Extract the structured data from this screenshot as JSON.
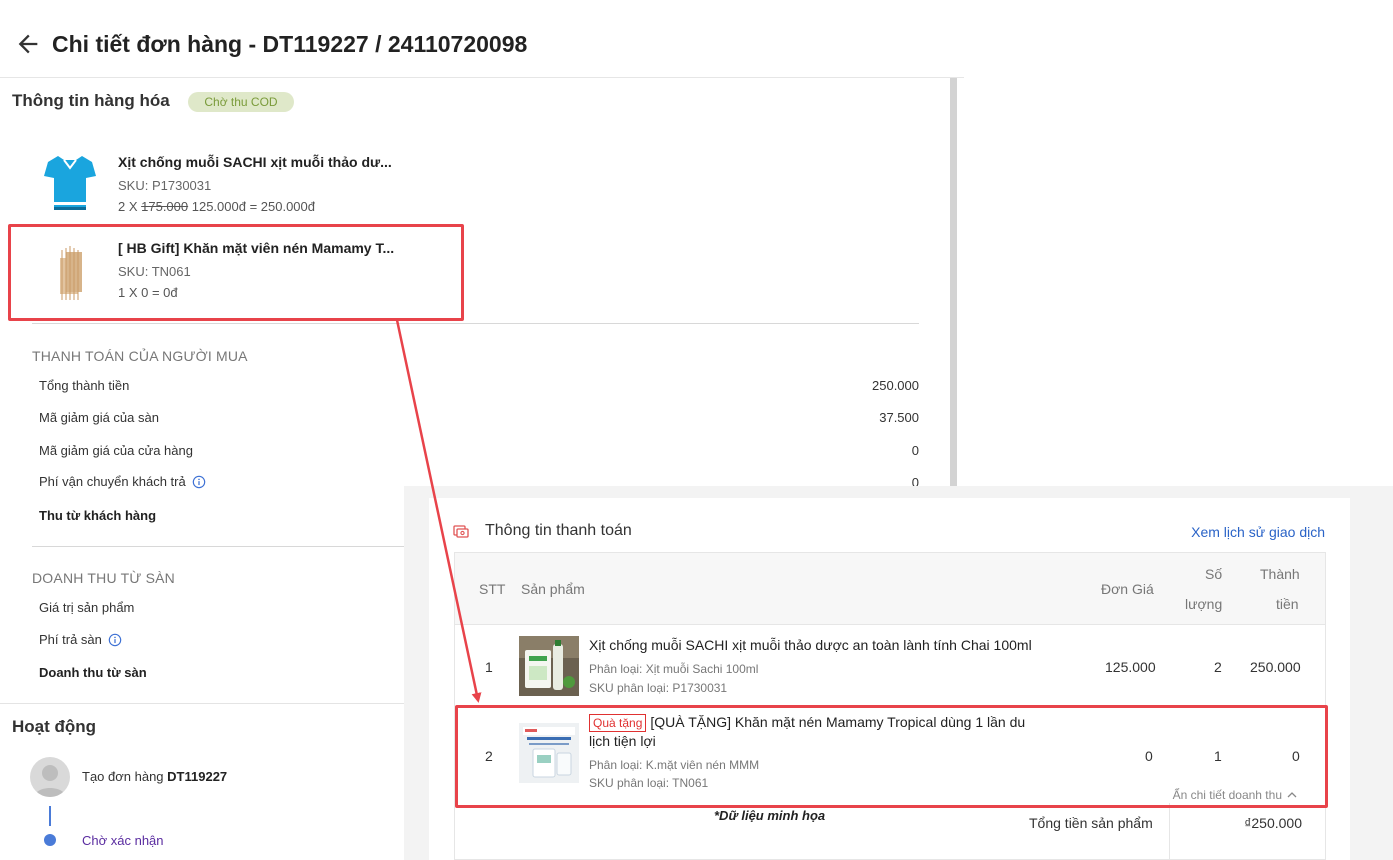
{
  "order": {
    "title": "Chi tiết đơn hàng - DT119227 / 24110720098"
  },
  "goods": {
    "heading": "Thông tin hàng hóa",
    "status_badge": "Chờ thu COD",
    "items": [
      {
        "name": "Xịt chống muỗi SACHI xịt muỗi thảo dư...",
        "sku": "SKU: P1730031",
        "qty_prefix": "2 X ",
        "old_price": "175.000",
        "price_suffix": " 125.000đ = 250.000đ",
        "icon": "tshirt-icon"
      },
      {
        "name": "[ HB Gift] Khăn mặt viên nén Mamamy T...",
        "sku": "SKU: TN061",
        "price_line": "1 X 0 = 0đ",
        "icon": "towel-icon"
      }
    ]
  },
  "buyer_payment": {
    "title": "THANH TOÁN CỦA NGƯỜI MUA",
    "rows": [
      {
        "label": "Tổng thành tiền",
        "value": "250.000"
      },
      {
        "label": "Mã giảm giá của sàn",
        "value": "37.500"
      },
      {
        "label": "Mã giảm giá của cửa hàng",
        "value": "0"
      },
      {
        "label": "Phí vận chuyển khách trả",
        "value": "0"
      },
      {
        "label": "Thu từ khách hàng",
        "value": ""
      }
    ]
  },
  "platform_revenue": {
    "title": "DOANH THU TỪ SÀN",
    "rows": [
      {
        "label": "Giá trị sản phẩm"
      },
      {
        "label": "Phí trả sàn"
      },
      {
        "label": "Doanh thu từ sàn"
      }
    ]
  },
  "activity": {
    "title": "Hoạt động",
    "created_prefix": "Tạo đơn hàng ",
    "created_order": "DT119227",
    "status": "Chờ xác nhận"
  },
  "payment_info": {
    "title": "Thông tin thanh toán",
    "history_link": "Xem lịch sử giao dịch",
    "columns": {
      "stt": "STT",
      "product": "Sản phẩm",
      "unit_price": "Đơn Giá",
      "qty_line1": "Số",
      "qty_line2": "lượng",
      "total_line1": "Thành",
      "total_line2": "tiền"
    },
    "rows": [
      {
        "stt": "1",
        "name": "Xịt chống muỗi SACHI xịt muỗi thảo dược an toàn lành tính Chai 100ml",
        "variant": "Phân loại: Xịt muỗi Sachi 100ml",
        "sku": "SKU phân loại: P1730031",
        "unit_price": "125.000",
        "qty": "2",
        "total": "250.000"
      },
      {
        "stt": "2",
        "gift_tag": "Quà tặng",
        "name": "[QUÀ TẶNG] Khăn mặt nén Mamamy Tropical dùng 1 lần du lịch tiện lợi",
        "variant": "Phân loại: K.mặt viên nén MMM",
        "sku": "SKU phân loại: TN061",
        "unit_price": "0",
        "qty": "1",
        "total": "0"
      }
    ],
    "collapse_link": "Ẩn chi tiết doanh thu",
    "footnote": "*Dữ liệu minh họa",
    "total_label": "Tổng tiền sản phẩm",
    "total_value": "₫250.000"
  },
  "colors": {
    "highlight": "#e8434a",
    "link": "#2a63c7",
    "badge_bg": "#dfe8c9",
    "badge_text": "#7a9b3a",
    "timeline": "#4a7bd8"
  }
}
